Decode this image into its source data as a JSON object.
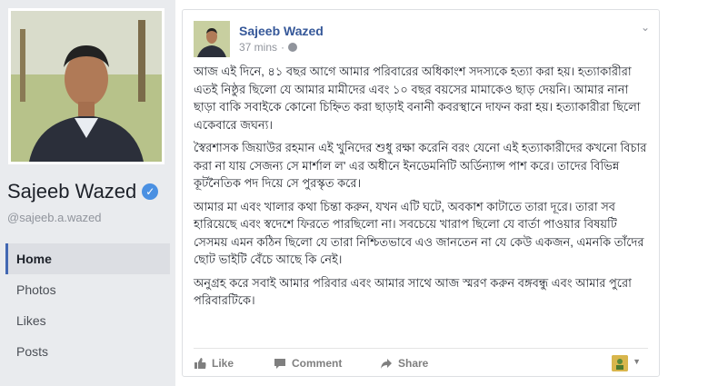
{
  "profile": {
    "name": "Sajeeb Wazed",
    "handle": "@sajeeb.a.wazed",
    "verified_icon": "verified-check-icon"
  },
  "nav": {
    "items": [
      {
        "label": "Home",
        "active": true
      },
      {
        "label": "Photos",
        "active": false
      },
      {
        "label": "Likes",
        "active": false
      },
      {
        "label": "Posts",
        "active": false
      }
    ]
  },
  "post": {
    "author": "Sajeeb Wazed",
    "time": "37 mins",
    "paragraphs": [
      "আজ এই দিনে, ৪১ বছর আগে আমার পরিবারের অধিকাংশ সদস্যকে হত্যা করা হয়। হত্যাকারীরা এতই নিষ্ঠুর ছিলো যে আমার মামীদের এবং ১০ বছর বয়সের মামাকেও ছাড় দেয়নি। আমার নানা ছাড়া বাকি সবাইকে কোনো চিহ্নিত করা ছাড়াই বনানী কবরস্থানে দাফন করা হয়। হত্যাকারীরা ছিলো একেবারে জঘন্য।",
      "স্বৈরশাসক জিয়াউর রহমান এই খুনিদের শুধু রক্ষা করেনি বরং যেনো এই হত্যাকারীদের কখনো বিচার করা না যায় সেজন্য সে মার্শাল ল' এর অধীনে ইনডেমনিটি অর্ডিন্যান্স পাশ করে। তাদের বিভিন্ন কূটনৈতিক পদ দিয়ে সে পুরস্কৃত করে।",
      "আমার মা এবং খালার কথা চিন্তা করুন, যখন এটি ঘটে, অবকাশ কাটাতে তারা দূরে। তারা সব হারিয়েছে এবং স্বদেশে ফিরতে পারছিলো না। সবচেয়ে খারাপ ছিলো যে বার্তা পাওয়ার বিষয়টি সেসময় এমন কঠিন ছিলো যে তারা নিশ্চিতভাবে এও জানতেন না যে কেউ একজন, এমনকি তাঁদের ছোট ভাইটি বেঁচে আছে কি নেই।",
      "অনুগ্রহ করে সবাই আমার পরিবার এবং আমার সাথে আজ স্মরণ করুন বঙ্গবন্ধু এবং আমার পুরো পরিবারটিকে।"
    ],
    "actions": {
      "like": "Like",
      "comment": "Comment",
      "share": "Share"
    }
  }
}
